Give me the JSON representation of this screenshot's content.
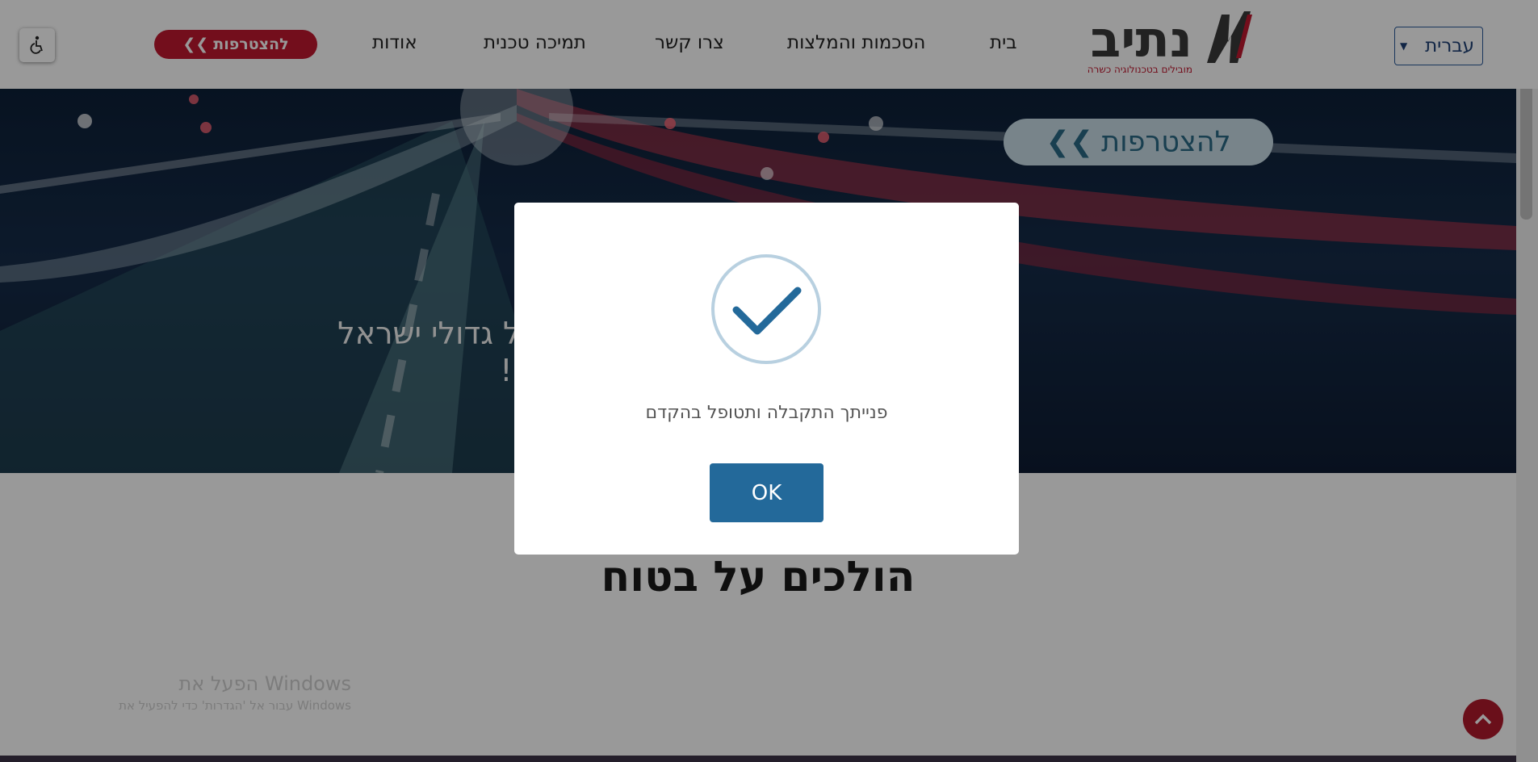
{
  "header": {
    "accessibility_icon": "wheelchair-icon",
    "join_button": {
      "label": "להצטרפות",
      "icon": "double-chevron-left-icon"
    },
    "nav": [
      "בית",
      "הסכמות והמלצות",
      "צרו קשר",
      "תמיכה טכנית",
      "אודות"
    ],
    "logo": {
      "name": "נתיב",
      "tagline": "מובילים בטכנולוגיה כשרה"
    },
    "language_select": {
      "value": "עברית",
      "icon": "chevron-down-icon"
    }
  },
  "hero": {
    "join_label": "להצטרפות",
    "text_line1": "אל גדולי ישראל",
    "text_line2": "ום!"
  },
  "section": {
    "title": "הולכים על בטוח"
  },
  "watermark": {
    "line1": "הפעל את Windows",
    "line2": "עבור אל 'הגדרות' כדי להפעיל את Windows"
  },
  "scroll_top_icon": "chevron-up-icon",
  "modal": {
    "icon": "success-check-icon",
    "message": "פנייתך התקבלה ותטופל בהקדם",
    "ok_label": "OK"
  },
  "colors": {
    "brand_red": "#c0182f",
    "ok_blue": "#23699a",
    "check_ring": "#b8d0e0",
    "check_mark": "#23699a"
  }
}
